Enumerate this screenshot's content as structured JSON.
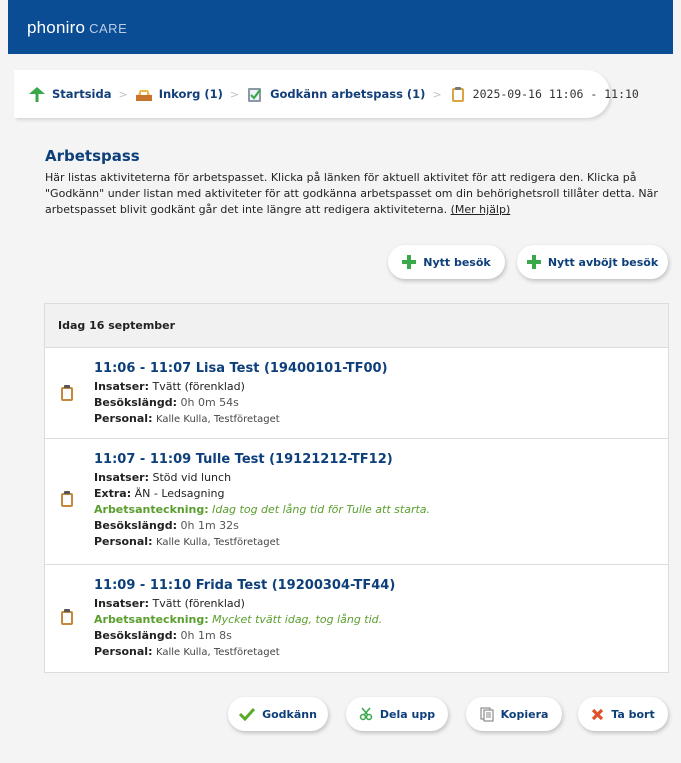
{
  "header": {
    "brand": "phoniro",
    "brand_suffix": "CARE"
  },
  "breadcrumb": [
    {
      "label": "Startsida",
      "icon": "home-icon"
    },
    {
      "label": "Inkorg (1)",
      "icon": "inbox-icon"
    },
    {
      "label": "Godkänn arbetspass (1)",
      "icon": "approve-shift-icon"
    },
    {
      "label": "2025-09-16 11:06 - 11:10",
      "icon": "clipboard-icon"
    }
  ],
  "page": {
    "title": "Arbetspass",
    "intro": "Här listas aktiviteterna för arbetspasset. Klicka på länken för aktuell aktivitet för att redigera den. Klicka på \"Godkänn\" under listan med aktiviteter för att godkänna arbetspasset om din behörighetsroll tillåter detta. När arbetspasset blivit godkänt går det inte längre att redigera aktiviteterna.",
    "help_link": "(Mer hjälp)"
  },
  "actions": {
    "new_visit": "Nytt besök",
    "new_declined_visit": "Nytt avböjt besök"
  },
  "day_header": "Idag 16 september",
  "labels": {
    "insatser": "Insatser:",
    "extra": "Extra:",
    "note": "Arbetsanteckning:",
    "length": "Besökslängd:",
    "personal": "Personal:"
  },
  "visits": [
    {
      "title": "11:06 - 11:07 Lisa Test (19400101-TF00)",
      "insatser": "Tvätt (förenklad)",
      "length": "0h 0m 54s",
      "personal": "Kalle Kulla, Testföretaget"
    },
    {
      "title": "11:07 - 11:09 Tulle Test (19121212-TF12)",
      "insatser": "Stöd vid lunch",
      "extra": "ÄN - Ledsagning",
      "note": "Idag tog det lång tid för Tulle att starta.",
      "length": "0h 1m 32s",
      "personal": "Kalle Kulla, Testföretaget"
    },
    {
      "title": "11:09 - 11:10 Frida Test (19200304-TF44)",
      "insatser": "Tvätt (förenklad)",
      "note": "Mycket tvätt idag, tog lång tid.",
      "length": "0h 1m 8s",
      "personal": "Kalle Kulla, Testföretaget"
    }
  ],
  "footer_actions": {
    "approve": "Godkänn",
    "split": "Dela upp",
    "copy": "Kopiera",
    "delete": "Ta bort"
  },
  "colors": {
    "topbar": "#0b4d94",
    "link": "#0d3f7a",
    "note_green": "#5a9e2d"
  }
}
